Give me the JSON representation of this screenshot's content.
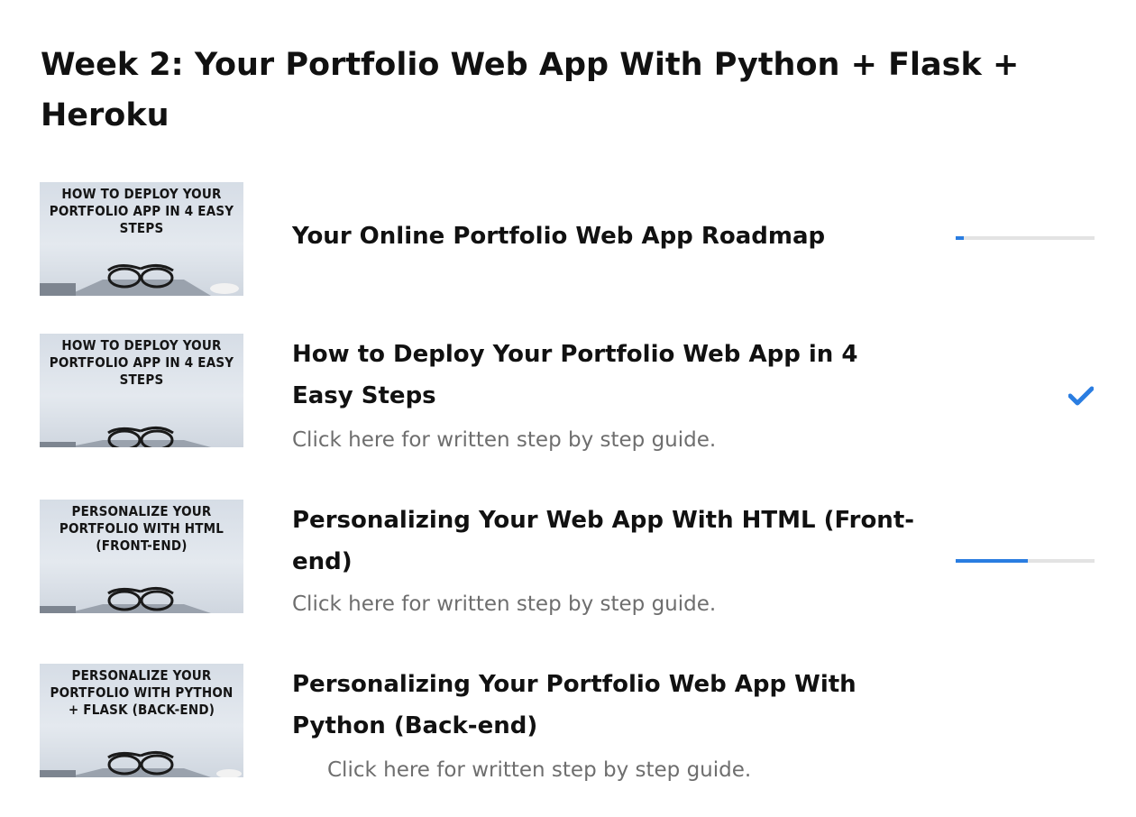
{
  "section": {
    "title": "Week 2: Your Portfolio Web App With Python + Flask + Heroku"
  },
  "lessons": [
    {
      "thumbnail_text": "How to Deploy Your Portfolio App in 4 Easy Steps",
      "title": "Your Online Portfolio Web App Roadmap",
      "progress": 0.06
    },
    {
      "thumbnail_text": "How to Deploy Your Portfolio App in 4 Easy Steps",
      "title": "How to Deploy Your Portfolio Web App in 4 Easy Steps",
      "subtitle": "Click here for written step by step guide.",
      "status_icon": "check-icon"
    },
    {
      "thumbnail_text": "Personalize Your Portfolio with HTML (Front-end)",
      "title": "Personalizing Your Web App With HTML (Front-end)",
      "subtitle": "Click here for written step by step guide.",
      "progress": 0.52
    },
    {
      "thumbnail_text": "Personalize Your Portfolio with Python + Flask (Back-end)",
      "title": "Personalizing Your Portfolio Web App With Python (Back-end)",
      "subtitle": "Click here for written step by step guide."
    }
  ],
  "colors": {
    "progress_fill": "#2a7de1",
    "progress_track": "#e3e3e3",
    "check": "#2a7de1",
    "subtitle_text": "#6e6e6e"
  }
}
